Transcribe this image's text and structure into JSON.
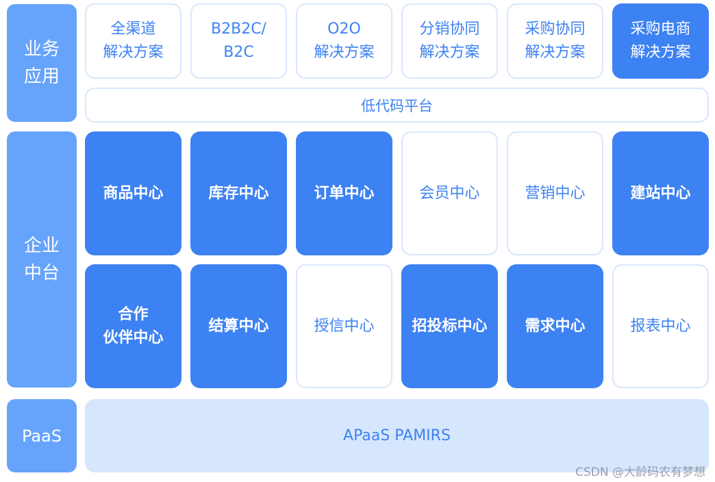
{
  "layers": {
    "business": "业务\n应用",
    "middle": "企业\n中台",
    "paas": "PaaS"
  },
  "solutions": [
    {
      "label": "全渠道\n解决方案",
      "style": "white"
    },
    {
      "label": "B2B2C/\nB2C",
      "style": "white"
    },
    {
      "label": "O2O\n解决方案",
      "style": "white"
    },
    {
      "label": "分销协同\n解决方案",
      "style": "white"
    },
    {
      "label": "采购协同\n解决方案",
      "style": "white"
    },
    {
      "label": "采购电商\n解决方案",
      "style": "blue"
    }
  ],
  "lowcode": "低代码平台",
  "centers_row1": [
    {
      "label": "商品中心",
      "style": "blue"
    },
    {
      "label": "库存中心",
      "style": "blue"
    },
    {
      "label": "订单中心",
      "style": "blue"
    },
    {
      "label": "会员中心",
      "style": "white"
    },
    {
      "label": "营销中心",
      "style": "white"
    },
    {
      "label": "建站中心",
      "style": "blue"
    }
  ],
  "centers_row2": [
    {
      "label": "合作\n伙伴中心",
      "style": "blue"
    },
    {
      "label": "结算中心",
      "style": "blue"
    },
    {
      "label": "授信中心",
      "style": "white"
    },
    {
      "label": "招投标中心",
      "style": "blue"
    },
    {
      "label": "需求中心",
      "style": "blue"
    },
    {
      "label": "报表中心",
      "style": "white"
    }
  ],
  "paas_platform": "APaaS  PAMIRS",
  "watermark": "CSDN @大龄码农有梦想"
}
